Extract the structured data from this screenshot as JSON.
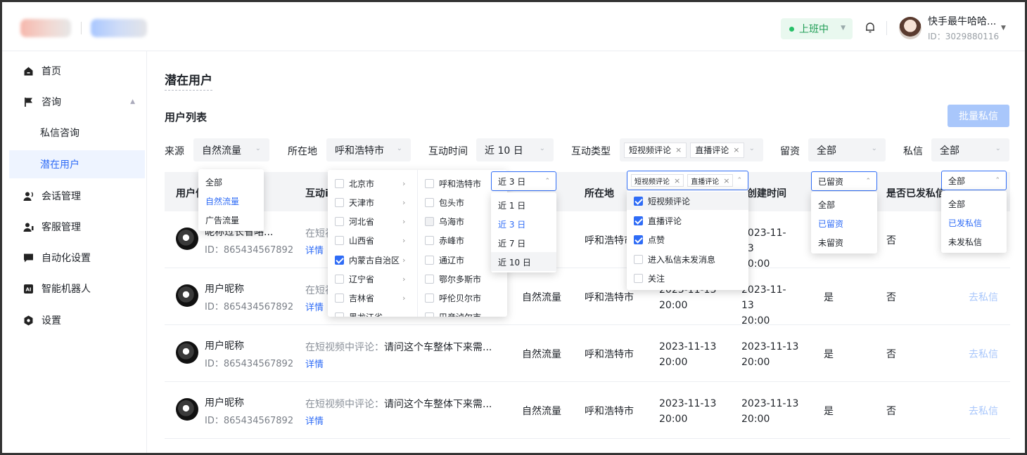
{
  "topbar": {
    "status_label": "上班中",
    "user_name": "快手最牛哈哈...",
    "user_id": "ID：3029880116"
  },
  "sidebar": {
    "items": [
      {
        "label": "首页",
        "icon": "home-icon"
      },
      {
        "label": "咨询",
        "icon": "flag-icon"
      },
      {
        "label": "私信咨询"
      },
      {
        "label": "潜在用户"
      },
      {
        "label": "会话管理",
        "icon": "users-icon"
      },
      {
        "label": "客服管理",
        "icon": "user-group-icon"
      },
      {
        "label": "自动化设置",
        "icon": "chat-icon"
      },
      {
        "label": "智能机器人",
        "icon": "ai-icon"
      },
      {
        "label": "设置",
        "icon": "gear-icon"
      }
    ]
  },
  "page": {
    "title": "潜在用户",
    "section_title": "用户列表",
    "bulk_button": "批量私信"
  },
  "filters": {
    "source_label": "来源",
    "source_value": "自然流量",
    "location_label": "所在地",
    "location_value": "呼和浩特市",
    "time_label": "互动时间",
    "time_value": "近 10 日",
    "type_label": "互动类型",
    "type_tags": [
      "短视频评论",
      "直播评论"
    ],
    "kept_label": "留资",
    "kept_value": "全部",
    "msg_label": "私信",
    "msg_value": "全部"
  },
  "table": {
    "headers": [
      "用户信",
      "互动i",
      "所在地",
      "创建时间",
      "是否已发私信"
    ],
    "rows": [
      {
        "name": "昵称过长省略...",
        "id": "ID：865434567892",
        "interaction_prefix": "在短视",
        "interaction_text": "",
        "detail": "详情",
        "source": "",
        "location": "呼和浩特市",
        "time1": "",
        "time2": "2023-11-13 20:00",
        "kept": "",
        "sent": "否",
        "action": ""
      },
      {
        "name": "用户昵称",
        "id": "ID：865434567892",
        "interaction_prefix": "在短视",
        "interaction_text": "",
        "detail": "详情",
        "source": "自然流量",
        "location": "呼和浩特市",
        "time1": "2023-11-13 20:00",
        "time2": "2023-11-13 20:00",
        "kept": "是",
        "sent": "否",
        "action": "去私信"
      },
      {
        "name": "用户昵称",
        "id": "ID：865434567892",
        "interaction_prefix": "在短视频中评论：",
        "interaction_text": "请问这个车整体下来需...",
        "detail": "详情",
        "source": "自然流量",
        "location": "呼和浩特市",
        "time1": "2023-11-13 20:00",
        "time2": "2023-11-13 20:00",
        "kept": "是",
        "sent": "否",
        "action": "去私信"
      },
      {
        "name": "用户昵称",
        "id": "ID：865434567892",
        "interaction_prefix": "在短视频中评论：",
        "interaction_text": "请问这个车整体下来需...",
        "detail": "详情",
        "source": "自然流量",
        "location": "呼和浩特市",
        "time1": "2023-11-13 20:00",
        "time2": "2023-11-13 20:00",
        "kept": "是",
        "sent": "否",
        "action": "去私信"
      }
    ]
  },
  "dropdowns": {
    "source_options": [
      "全部",
      "自然流量",
      "广告流量"
    ],
    "provinces": [
      "北京市",
      "天津市",
      "河北省",
      "山西省",
      "内蒙古自治区",
      "辽宁省",
      "吉林省",
      "黑龙江省"
    ],
    "cities": [
      "呼和浩特市",
      "包头市",
      "乌海市",
      "赤峰市",
      "通辽市",
      "鄂尔多斯市",
      "呼伦贝尔市",
      "巴彦淖尔市"
    ],
    "time_trigger": "近 3 日",
    "time_options": [
      "近 1 日",
      "近 3 日",
      "近 7 日",
      "近 10 日"
    ],
    "type_trigger_tags": [
      "短视频评论",
      "直播评论"
    ],
    "type_options": [
      "短视频评论",
      "直播评论",
      "点赞",
      "进入私信未发消息",
      "关注"
    ],
    "kept_trigger": "已留资",
    "kept_options": [
      "全部",
      "已留资",
      "未留资"
    ],
    "msg_trigger": "全部",
    "msg_options": [
      "全部",
      "已发私信",
      "未发私信"
    ]
  },
  "colors": {
    "accent": "#2f6cf6",
    "status_green": "#27c068",
    "disabled_blue": "#a9c7fb"
  }
}
